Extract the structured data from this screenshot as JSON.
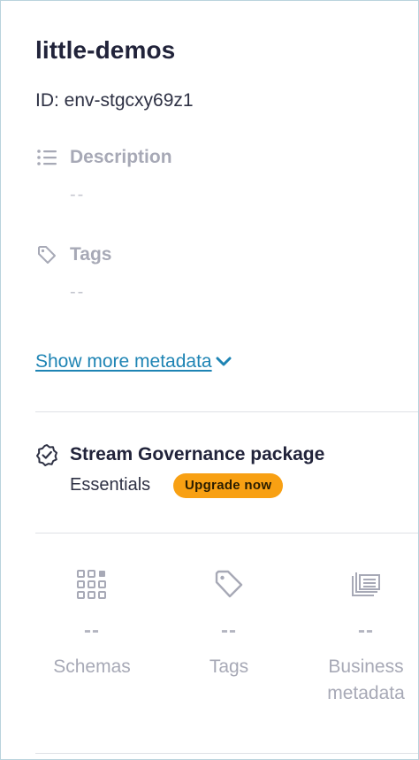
{
  "environment": {
    "name": "little-demos",
    "id_text": "ID: env-stgcxy69z1"
  },
  "metadata": {
    "description_label": "Description",
    "description_value": "--",
    "tags_label": "Tags",
    "tags_value": "--",
    "show_more_label": "Show more metadata"
  },
  "governance": {
    "title": "Stream Governance package",
    "tier": "Essentials",
    "upgrade_label": "Upgrade now"
  },
  "stats": [
    {
      "label": "Schemas",
      "count": "--",
      "icon": "grid-icon"
    },
    {
      "label": "Tags",
      "count": "--",
      "icon": "tag-icon"
    },
    {
      "label": "Business metadata",
      "count": "--",
      "icon": "stacked-cards-icon"
    }
  ],
  "colors": {
    "link": "#1e84b4",
    "badge": "#f8a013",
    "muted": "#a7a9b6"
  }
}
